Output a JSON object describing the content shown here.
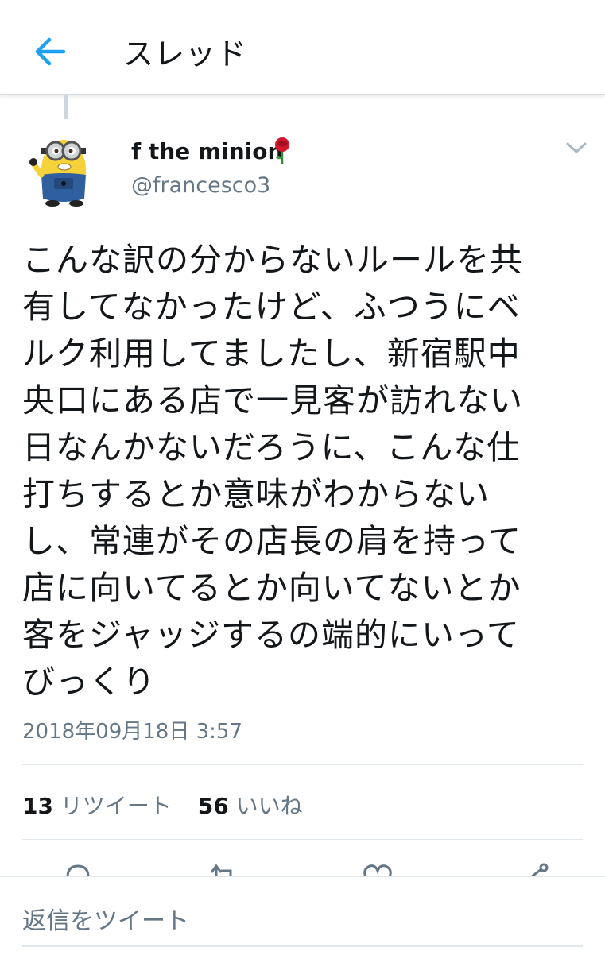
{
  "header": {
    "title": "スレッド",
    "back_icon": "back-arrow-icon",
    "accent_color": "#1da1f2"
  },
  "tweet": {
    "display_name": "f the minion",
    "name_emoji": "rose-icon",
    "handle": "@francesco3",
    "text_lines": [
      "こんな訳の分からないルールを共",
      "有してなかったけど、ふつうにベ",
      "ルク利用してましたし、新宿駅中",
      "央口にある店で一見客が訪れない",
      "日なんかないだろうに、こんな仕",
      "打ちするとか意味がわからない",
      "し、常連がその店長の肩を持って",
      "店に向いてるとか向いてないとか",
      "客をジャッジするの端的にいって",
      "びっくり"
    ],
    "timestamp": "2018年09月18日 3:57"
  },
  "stats": {
    "retweets_count": "13",
    "retweets_label": "リツイート",
    "likes_count": "56",
    "likes_label": "いいね"
  },
  "actions": [
    {
      "icon": "reply-icon"
    },
    {
      "icon": "retweet-icon"
    },
    {
      "icon": "like-icon"
    },
    {
      "icon": "share-icon"
    }
  ],
  "reply": {
    "placeholder": "返信をツイート"
  }
}
